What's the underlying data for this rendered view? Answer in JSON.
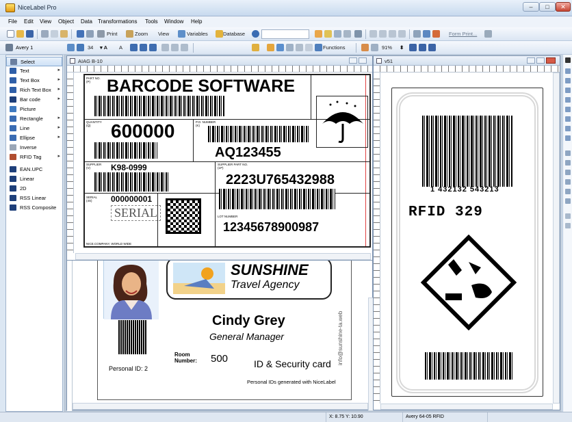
{
  "app": {
    "title": "NiceLabel Pro"
  },
  "menu": [
    "File",
    "Edit",
    "View",
    "Object",
    "Data",
    "Transformations",
    "Tools",
    "Window",
    "Help"
  ],
  "toolbar1": {
    "print": "Print",
    "zoom": "Zoom",
    "view": "View",
    "variables": "Variables",
    "database": "Database",
    "form_print": "Form Print..."
  },
  "toolbar2": {
    "printer": "Avery 1",
    "font_size": "34",
    "functions": "Functions",
    "zoom_pct": "91%"
  },
  "tools": [
    {
      "label": "Select",
      "icon": "pointer-icon",
      "color": "#6a7fa0"
    },
    {
      "label": "Text",
      "icon": "text-icon",
      "color": "#2f5fa8"
    },
    {
      "label": "Text Box",
      "icon": "text-box-icon",
      "color": "#2f5fa8"
    },
    {
      "label": "Rich Text Box",
      "icon": "rich-text-icon",
      "color": "#2f5fa8"
    },
    {
      "label": "Bar code",
      "icon": "barcode-icon",
      "color": "#1e3f7a"
    },
    {
      "label": "Picture",
      "icon": "picture-icon",
      "color": "#3f7ac0"
    },
    {
      "label": "Rectangle",
      "icon": "rectangle-icon",
      "color": "#3a6cb3"
    },
    {
      "label": "Line",
      "icon": "line-icon",
      "color": "#3a6cb3"
    },
    {
      "label": "Ellipse",
      "icon": "ellipse-icon",
      "color": "#3a6cb3"
    },
    {
      "label": "Inverse",
      "icon": "inverse-icon",
      "color": "#9aa6b6"
    },
    {
      "label": "RFID Tag",
      "icon": "rfid-icon",
      "color": "#b04d2f"
    },
    {
      "label": "EAN.UPC",
      "icon": "ean-icon",
      "color": "#1e3f7a"
    },
    {
      "label": "Linear",
      "icon": "linear-barcode-icon",
      "color": "#1e3f7a"
    },
    {
      "label": "2D",
      "icon": "2d-barcode-icon",
      "color": "#1e3f7a"
    },
    {
      "label": "RSS Linear",
      "icon": "rss-linear-icon",
      "color": "#1e3f7a"
    },
    {
      "label": "RSS Composite",
      "icon": "rss-composite-icon",
      "color": "#1e3f7a"
    }
  ],
  "doc1": {
    "title": "AIAG B-10",
    "brand": "BARCODE SOFTWARE",
    "part_no_label": "PART NO.\n(P)",
    "quantity_label": "QUANTITY\n(Q)",
    "quantity": "600000",
    "po_label": "P.O. NUMBER\n(K)",
    "po_value": "AQ123455",
    "supplier_label": "SUPPLIER\n(V)",
    "supplier_value": "K98-0999",
    "supplier_part_label": "SUPPLIER PART NO.\n(1P)",
    "supplier_part_value": "2223U765432988",
    "serial_label": "SERIAL\n(4S)",
    "serial_value": "000000001",
    "serial_stamp": "SERIAL",
    "lot_label": "LOT NUMBER",
    "lot_value": "12345678900987",
    "company": "NICE.COMPANY, WORLD WIDE"
  },
  "doc2": {
    "title": "v51",
    "barcode_digits": "1  432132  543213",
    "rfid_text": "RFID  329"
  },
  "badge": {
    "company": "SUNSHINE",
    "tagline": "Travel Agency",
    "side_text": "info@sunshine-ta.web",
    "name": "Cindy Grey",
    "position": "General Manager",
    "room_label": "Room\nNumber:",
    "room": "500",
    "card_title": "ID & Security card",
    "personal_id": "Personal ID: 2",
    "footer": "Personal IDs generated with NiceLabel"
  },
  "status": {
    "coords": "X: 8.75 Y: 10.90",
    "printer": "Avery 64-05 RFID"
  }
}
